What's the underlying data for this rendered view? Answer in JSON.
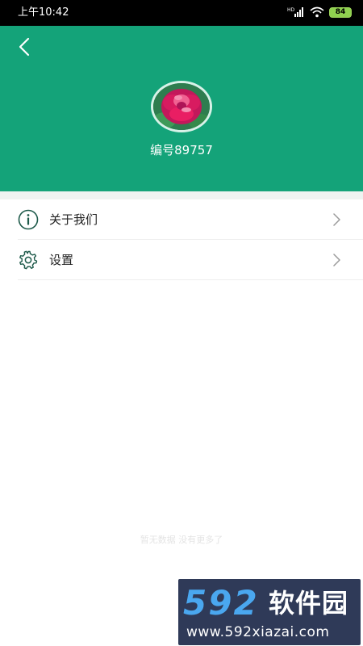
{
  "status_bar": {
    "time": "上午10:42",
    "battery": "84",
    "icons": [
      "hd-icon",
      "signal-icon",
      "wifi-icon",
      "battery-icon"
    ]
  },
  "header": {
    "background_color": "#14a379",
    "back_icon": "chevron-left-icon",
    "username": "编号89757"
  },
  "menu": {
    "items": [
      {
        "label": "关于我们",
        "icon": "info-icon"
      },
      {
        "label": "设置",
        "icon": "gear-icon"
      }
    ]
  },
  "footer": {
    "faint_text": "暂无数据 没有更多了"
  },
  "watermark": {
    "number": "592",
    "brand": "软件园",
    "url": "www.592xiazai.com"
  }
}
